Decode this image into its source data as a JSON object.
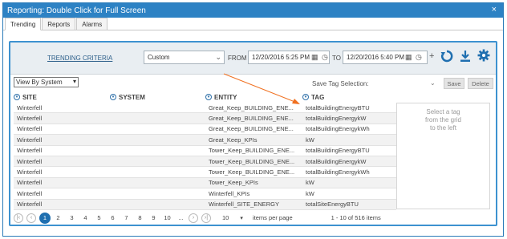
{
  "window": {
    "title": "Reporting: Double Click for Full Screen",
    "close_glyph": "×"
  },
  "tabs": [
    {
      "label": "Trending"
    },
    {
      "label": "Reports"
    },
    {
      "label": "Alarms"
    }
  ],
  "criteria": {
    "link_label": "TRENDING CRITERIA",
    "range_select": "Custom",
    "from_label": "FROM",
    "from_value": "12/20/2016 5:25 PM",
    "to_label": "TO",
    "to_value": "12/20/2016 5:40 PM",
    "plus": "+"
  },
  "view_by": {
    "value": "View By System"
  },
  "save_tag": {
    "label": "Save Tag Selection:",
    "save_button": "Save",
    "delete_button": "Delete"
  },
  "grid": {
    "columns": [
      "SITE",
      "SYSTEM",
      "ENTITY",
      "TAG"
    ],
    "rows": [
      [
        "Winterfell",
        "",
        "Great_Keep_BUILDING_ENE...",
        "totalBuildingEnergyBTU"
      ],
      [
        "Winterfell",
        "",
        "Great_Keep_BUILDING_ENE...",
        "totalBuildingEnergykW"
      ],
      [
        "Winterfell",
        "",
        "Great_Keep_BUILDING_ENE...",
        "totalBuildingEnergykWh"
      ],
      [
        "Winterfell",
        "",
        "Great_Keep_KPIs",
        "kW"
      ],
      [
        "Winterfell",
        "",
        "Tower_Keep_BUILDING_ENE...",
        "totalBuildingEnergyBTU"
      ],
      [
        "Winterfell",
        "",
        "Tower_Keep_BUILDING_ENE...",
        "totalBuildingEnergykW"
      ],
      [
        "Winterfell",
        "",
        "Tower_Keep_BUILDING_ENE...",
        "totalBuildingEnergykWh"
      ],
      [
        "Winterfell",
        "",
        "Tower_Keep_KPIs",
        "kW"
      ],
      [
        "Winterfell",
        "",
        "Winterfell_KPIs",
        "kW"
      ],
      [
        "Winterfell",
        "",
        "Winterfell_SITE_ENERGY",
        "totalSiteEnergyBTU"
      ]
    ]
  },
  "tag_pane": {
    "line1": "Select a tag",
    "line2": "from the grid",
    "line3": "to the left"
  },
  "pager": {
    "first": "|‹",
    "prev": "‹",
    "next": "›",
    "last": "›|",
    "pages": [
      "1",
      "2",
      "3",
      "4",
      "5",
      "6",
      "7",
      "8",
      "9",
      "10",
      "..."
    ],
    "page_size": "10",
    "page_size_label": "items per page",
    "summary": "1 - 10 of 516 items"
  },
  "colors": {
    "title_bar": "#2d82c4",
    "panel_border": "#3d92d0",
    "accent": "#1f6fb0",
    "annotation_arrow": "#f07020"
  },
  "icons": [
    "calendar-icon",
    "clock-icon",
    "refresh-icon",
    "download-icon",
    "gear-icon",
    "filter-icon"
  ]
}
